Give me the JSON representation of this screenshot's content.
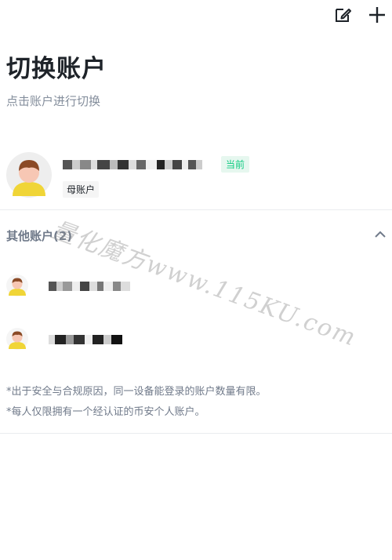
{
  "header": {
    "edit_icon": "edit-icon",
    "add_icon": "plus-icon"
  },
  "page": {
    "title": "切换账户",
    "subtitle": "点击账户进行切换"
  },
  "current_account": {
    "badge_current": "当前",
    "badge_parent": "母账户",
    "avatar_icon": "user-avatar-icon"
  },
  "others": {
    "label": "其他账户(2)",
    "chevron_icon": "chevron-up-icon",
    "count": 2
  },
  "notes": [
    "*出于安全与合规原因，同一设备能登录的账户数量有限。",
    "*每人仅限拥有一个经认证的币安个人账户。"
  ],
  "watermark": "量化魔方www.115KU.com",
  "colors": {
    "accent_green": "#0ecb81",
    "avatar_yellow": "#f0d537",
    "avatar_hair": "#8b4a26",
    "avatar_skin": "#f7c7b4"
  }
}
